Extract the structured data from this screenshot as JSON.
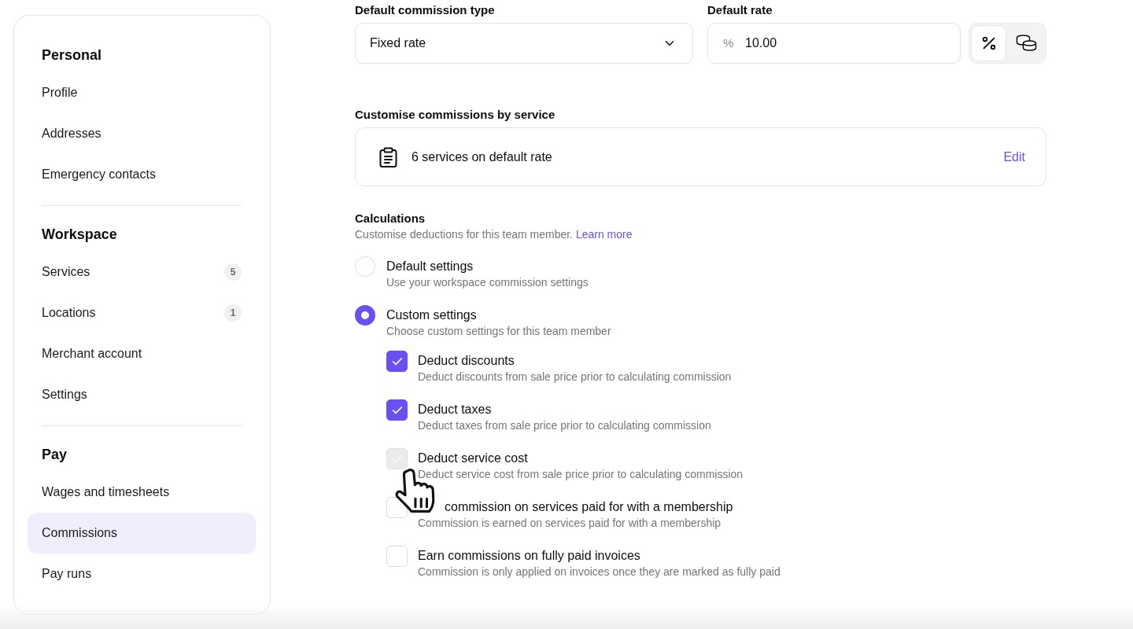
{
  "sidebar": {
    "sections": [
      {
        "title": "Personal",
        "items": [
          {
            "label": "Profile",
            "selected": false
          },
          {
            "label": "Addresses",
            "selected": false
          },
          {
            "label": "Emergency contacts",
            "selected": false
          }
        ]
      },
      {
        "title": "Workspace",
        "items": [
          {
            "label": "Services",
            "badge": "5",
            "selected": false
          },
          {
            "label": "Locations",
            "badge": "1",
            "selected": false
          },
          {
            "label": "Merchant account",
            "selected": false
          },
          {
            "label": "Settings",
            "selected": false
          }
        ]
      },
      {
        "title": "Pay",
        "items": [
          {
            "label": "Wages and timesheets",
            "selected": false
          },
          {
            "label": "Commissions",
            "selected": true
          },
          {
            "label": "Pay runs",
            "selected": false
          }
        ]
      }
    ]
  },
  "default_commission_type": {
    "label": "Default commission type",
    "value": "Fixed rate"
  },
  "default_rate": {
    "label": "Default rate",
    "prefix": "%",
    "value": "10.00",
    "units": [
      {
        "kind": "percent",
        "selected": true
      },
      {
        "kind": "amount",
        "selected": false
      }
    ]
  },
  "services": {
    "title": "Customise commissions by service",
    "summary": "6 services on default rate",
    "action": "Edit"
  },
  "calculations": {
    "title": "Calculations",
    "description": "Customise deductions for this team member.",
    "link": "Learn more",
    "modes": [
      {
        "label": "Default settings",
        "description": "Use your workspace commission settings",
        "selected": false
      },
      {
        "label": "Custom settings",
        "description": "Choose custom settings for this team member",
        "selected": true
      }
    ],
    "options": [
      {
        "label": "Deduct discounts",
        "description": "Deduct discounts from sale price prior to calculating commission",
        "checked": true,
        "hovered": false
      },
      {
        "label": "Deduct taxes",
        "description": "Deduct taxes from sale price prior to calculating commission",
        "checked": true,
        "hovered": false
      },
      {
        "label": "Deduct service cost",
        "description": "Deduct service cost from sale price prior to calculating commission",
        "checked": false,
        "hovered": true
      },
      {
        "label": "commission on services paid for with a membership",
        "description": "Commission is earned on services paid for with a membership",
        "checked": false,
        "hovered": false
      },
      {
        "label": "Earn commissions on fully paid invoices",
        "description": "Commission is only applied on invoices once they are marked as fully paid",
        "checked": false,
        "hovered": false
      }
    ]
  }
}
